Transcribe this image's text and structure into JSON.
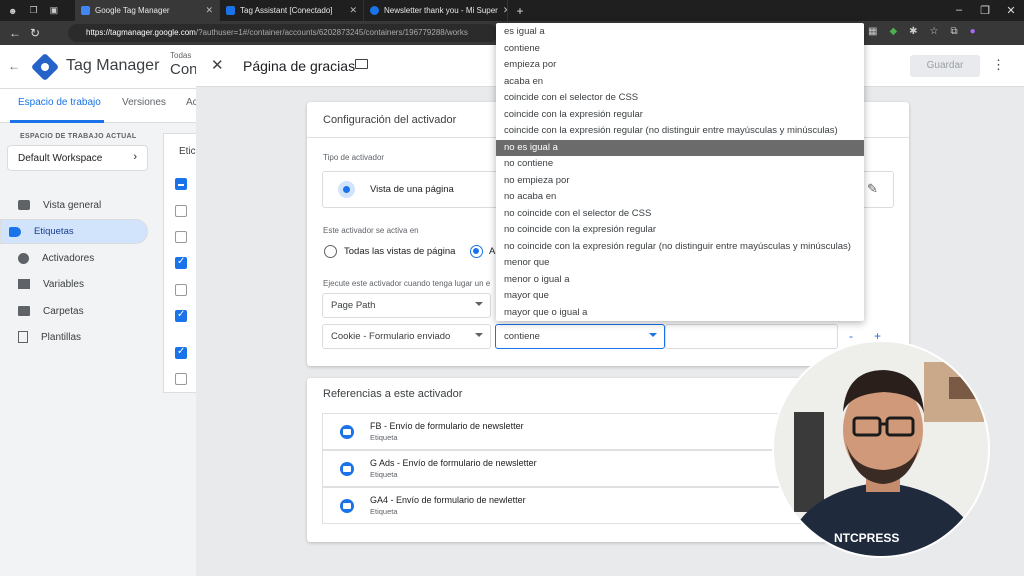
{
  "browser": {
    "tabs": [
      {
        "label": "Google Tag Manager",
        "color": "#4285f4"
      },
      {
        "label": "Tag Assistant [Conectado]",
        "color": "#1a73e8"
      },
      {
        "label": "Newsletter thank you - Mi Super",
        "color": "#1a73e8"
      }
    ],
    "url_host": "https://tagmanager.google.com",
    "url_rest": "/?authuser=1#/container/accounts/6202873245/containers/196779288/works"
  },
  "gtm": {
    "app_name": "Tag Manager",
    "container_small": "Todas",
    "container_big": "Con",
    "workspace_tabs": [
      "Espacio de trabajo",
      "Versiones",
      "Ac"
    ],
    "workspace_label": "ESPACIO DE TRABAJO ACTUAL",
    "workspace_name": "Default Workspace",
    "nav": [
      "Vista general",
      "Etiquetas",
      "Activadores",
      "Variables",
      "Carpetas",
      "Plantillas"
    ],
    "list_header": "Etic"
  },
  "panel": {
    "title": "Página de gracias",
    "save_label": "Guardar",
    "config_title": "Configuración del activador",
    "type_label": "Tipo de activador",
    "type_value": "Vista de una página",
    "fires_label": "Este activador se activa en",
    "radio_all": "Todas las vistas de página",
    "radio_some": "A",
    "condition_label": "Ejecute este activador cuando tenga lugar un e",
    "cond1_var": "Page Path",
    "cond2_var": "Cookie - Formulario enviado",
    "cond2_op": "contiene",
    "minus": "-",
    "plus": "+",
    "refs_title": "Referencias a este activador",
    "refs": [
      {
        "name": "FB - Envío de formulario de newsletter",
        "sub": "Etiqueta"
      },
      {
        "name": "G Ads - Envío de formulario de newsletter",
        "sub": "Etiqueta"
      },
      {
        "name": "GA4 - Envío de formulario de newletter",
        "sub": "Etiqueta"
      }
    ]
  },
  "dropdown": {
    "options": [
      "es igual a",
      "contiene",
      "empieza por",
      "acaba en",
      "coincide con el selector de CSS",
      "coincide con la expresión regular",
      "coincide con la expresión regular (no distinguir entre mayúsculas y minúsculas)",
      "no es igual a",
      "no contiene",
      "no empieza por",
      "no acaba en",
      "no coincide con el selector de CSS",
      "no coincide con la expresión regular",
      "no coincide con la expresión regular (no distinguir entre mayúsculas y minúsculas)",
      "menor que",
      "menor o igual a",
      "mayor que",
      "mayor que o igual a"
    ],
    "highlighted": "no es igual a"
  }
}
